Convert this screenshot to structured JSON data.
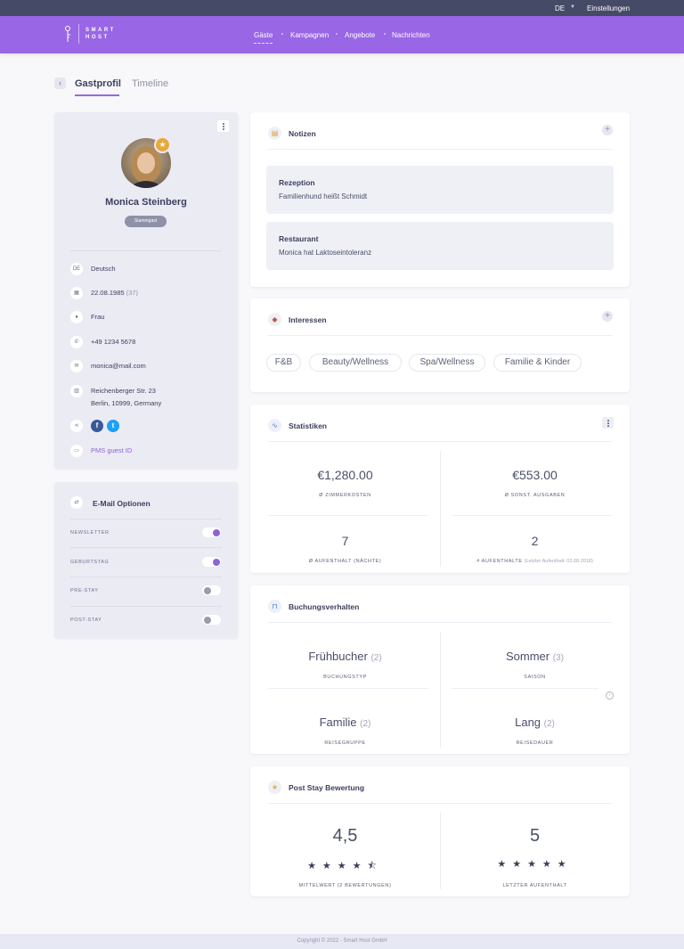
{
  "topbar": {
    "language": "DE",
    "settings": "Einstellungen"
  },
  "brand": {
    "line1": "SMART",
    "line2": "HOST"
  },
  "nav": {
    "items": [
      "Gäste",
      "Kampagnen",
      "Angebote",
      "Nachrichten"
    ],
    "active": "Gäste"
  },
  "tabs": {
    "profile": "Gastprofil",
    "timeline": "Timeline"
  },
  "guest": {
    "name": "Monica Steinberg",
    "badge": "Stammgast",
    "language_code": "DE",
    "language": "Deutsch",
    "birthdate": "22.08.1985",
    "age": "(37)",
    "gender": "Frau",
    "phone": "+49 1234 5678",
    "email": "monica@mail.com",
    "address_line1": "Reichenberger Str. 23",
    "address_line2": "Berlin, 10999, Germany",
    "pms": "PMS guest ID"
  },
  "email_options": {
    "title": "E-Mail Optionen",
    "items": [
      {
        "label": "NEWSLETTER",
        "on": true
      },
      {
        "label": "GEBURTSTAG",
        "on": true
      },
      {
        "label": "PRE-STAY",
        "on": false
      },
      {
        "label": "POST-STAY",
        "on": false
      }
    ]
  },
  "notes": {
    "title": "Notizen",
    "items": [
      {
        "title": "Rezeption",
        "text": "Familienhund heißt Schmidt"
      },
      {
        "title": "Restaurant",
        "text": "Monica hat Laktoseintoleranz"
      }
    ]
  },
  "interests": {
    "title": "Interessen",
    "items": [
      "F&B",
      "Beauty/Wellness",
      "Spa/Wellness",
      "Familie & Kinder"
    ]
  },
  "statistics": {
    "title": "Statistiken",
    "room_cost": "€1,280.00",
    "room_cost_label": "Ø ZIMMERKOSTEN",
    "other_expenses": "€553.00",
    "other_expenses_label": "Ø SONST. AUSGABEN",
    "avg_stay": "7",
    "avg_stay_label": "Ø AUFENTHALT (NÄCHTE)",
    "stays": "2",
    "stays_label": "# AUFENTHALTE",
    "last_stay_note": "(Letzter Aufenthalt: 02.08.2018)"
  },
  "booking": {
    "title": "Buchungsverhalten",
    "items": [
      {
        "value": "Frühbucher",
        "count": "(2)",
        "label": "BUCHUNGSTYP"
      },
      {
        "value": "Sommer",
        "count": "(3)",
        "label": "SAISON"
      },
      {
        "value": "Familie",
        "count": "(2)",
        "label": "REISEGRUPPE"
      },
      {
        "value": "Lang",
        "count": "(2)",
        "label": "REISEDAUER"
      }
    ]
  },
  "rating": {
    "title": "Post Stay Bewertung",
    "average": "4,5",
    "average_stars": 4.5,
    "average_label": "MITTELWERT (2 BEWERTUNGEN)",
    "last": "5",
    "last_stars": 5,
    "last_label": "LETZTER AUFENTHALT"
  },
  "footer": "Copyright © 2022 - Smart Host GmbH",
  "colors": {
    "accent": "#9966e6",
    "topbar": "#454a66",
    "star_badge": "#e8a93a"
  }
}
